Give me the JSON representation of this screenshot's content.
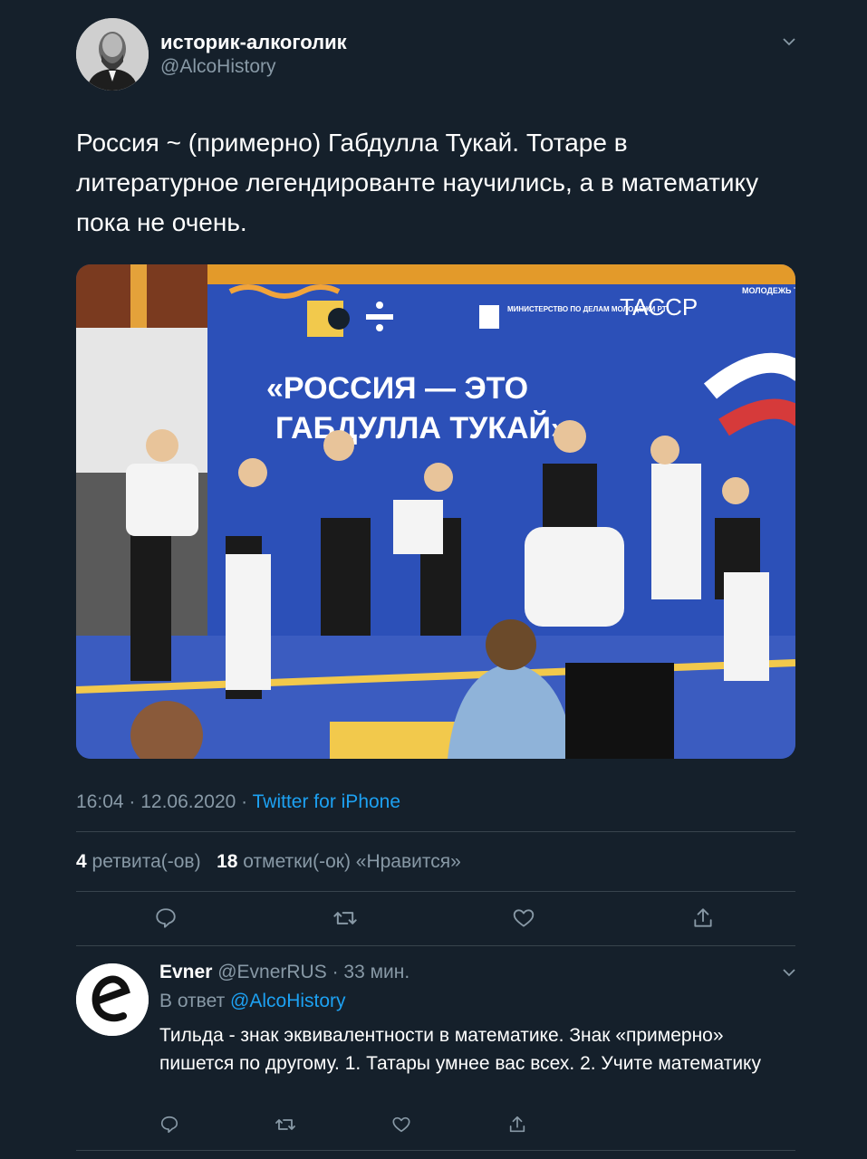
{
  "tweet": {
    "display_name": "историк-алкоголик",
    "handle": "@AlcoHistory",
    "text": "Россия ~ (примерно) Габдулла Тукай. Тотаре в литературное легендированте научились, а в математику пока не очень.",
    "media": {
      "banner_line1": "«РОССИЯ — ЭТО",
      "banner_line2": "ГАБДУЛЛА ТУКАЙ»",
      "sponsor1": "МИНИСТЕРСТВО ПО ДЕЛАМ МОЛОДЕЖИ РТ",
      "sponsor2": "TACCP",
      "sponsor3": "МОЛОДЕЖЬ ТАТАРСТАНА"
    },
    "time": "16:04 · 12.06.2020 ·",
    "source": "Twitter for iPhone",
    "retweets_count": "4",
    "retweets_label": "ретвита(-ов)",
    "likes_count": "18",
    "likes_label": "отметки(-ок) «Нравится»"
  },
  "reply": {
    "display_name": "Evner",
    "handle": "@EvnerRUS",
    "time": "· 33 мин.",
    "reply_prefix": "В ответ",
    "reply_to": "@AlcoHistory",
    "text": "Тильда - знак эквивалентности в математике. Знак «примерно» пишется по другому. 1. Татары умнее вас всех. 2. Учите математику"
  },
  "icons": [
    "chevron-down-icon",
    "reply-icon",
    "retweet-icon",
    "like-icon",
    "share-icon"
  ],
  "colors": {
    "background": "#15202b",
    "secondary_text": "#8899a6",
    "link": "#1da1f2",
    "divider": "#38444d"
  }
}
